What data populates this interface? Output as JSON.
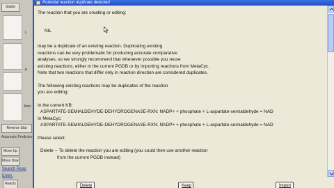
{
  "background_app": {
    "top_button": "Statist",
    "side_marks": [
      "L",
      "P",
      "Amo"
    ],
    "reverse_label": "Reverse Stat",
    "small_label": "Automatic Prediction",
    "move_up": "Move Up",
    "move_down": "Move Down",
    "search_link": "Search Reac",
    "bottom_link": "Enter.",
    "tab_label": "Reacts"
  },
  "dialog": {
    "title": "Potential reaction duplicate detected",
    "intro": "The reaction that you are creating or editing:",
    "reaction_name": "NIL",
    "warning_lines": [
      "may be a duplicate of an existing reaction.  Duplicating existing",
      "reactions can be very problematic for producing accurate comparative",
      "analyses, so we strongly recommend that whenever possible you reuse",
      "existing reactions, either in the current PGDB or by importing reactions from MetaCyc.",
      "Note that two reactions that differ only in reaction direction are considered duplicates."
    ],
    "duplicates_intro": [
      "The following existing reactions may be duplicates of the reaction",
      "you are editing:"
    ],
    "current_kb_label": "In the current KB:",
    "current_kb_reaction": "ASPARTATE-SEMIALDEHYDE-DEHYDROGENASE-RXN: NADP+ + phosphate + L-aspartate-semialdehyde  =  NAD",
    "metacyc_label": "In MetaCyc:",
    "metacyc_reaction": "ASPARTATE-SEMIALDEHYDE-DEHYDROGENASE-RXN: NADP+ + phosphate + L-aspartate-semialdehyde  =  NAD",
    "please_select": "Please select:",
    "option_delete_lines": [
      "Delete -- To delete the reaction you are editing (you could then use another reaction",
      "from the current PGDB instead)"
    ],
    "buttons": {
      "delete": "Delete",
      "keep": "Keep",
      "import": "Import"
    }
  },
  "colors": {
    "titlebar": "#2a58d0",
    "dialog_bg": "#ece9d8",
    "text": "#111111"
  }
}
